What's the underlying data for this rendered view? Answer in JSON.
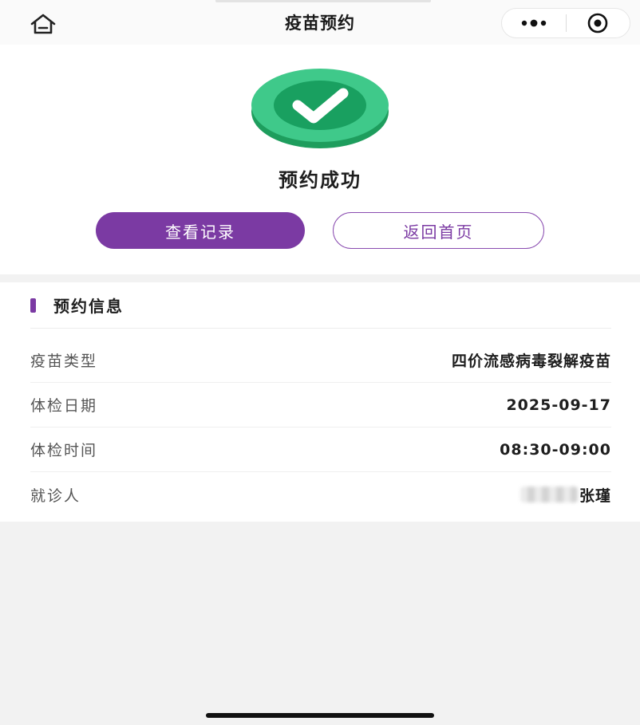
{
  "navbar": {
    "title": "疫苗预约",
    "home_icon": "home-icon",
    "more_icon": "more-dots-icon",
    "close_icon": "target-circle-icon"
  },
  "result": {
    "icon": "check-circle-icon",
    "message": "预约成功",
    "view_records_label": "查看记录",
    "back_home_label": "返回首页"
  },
  "info": {
    "title": "预约信息",
    "rows": [
      {
        "key": "疫苗类型",
        "value": "四价流感病毒裂解疫苗"
      },
      {
        "key": "体检日期",
        "value": "2025-09-17"
      },
      {
        "key": "体检时间",
        "value": "08:30-09:00"
      },
      {
        "key": "就诊人",
        "value": "张瑾"
      }
    ]
  },
  "colors": {
    "accent": "#7b3aa3",
    "success_green": "#2fb874"
  }
}
